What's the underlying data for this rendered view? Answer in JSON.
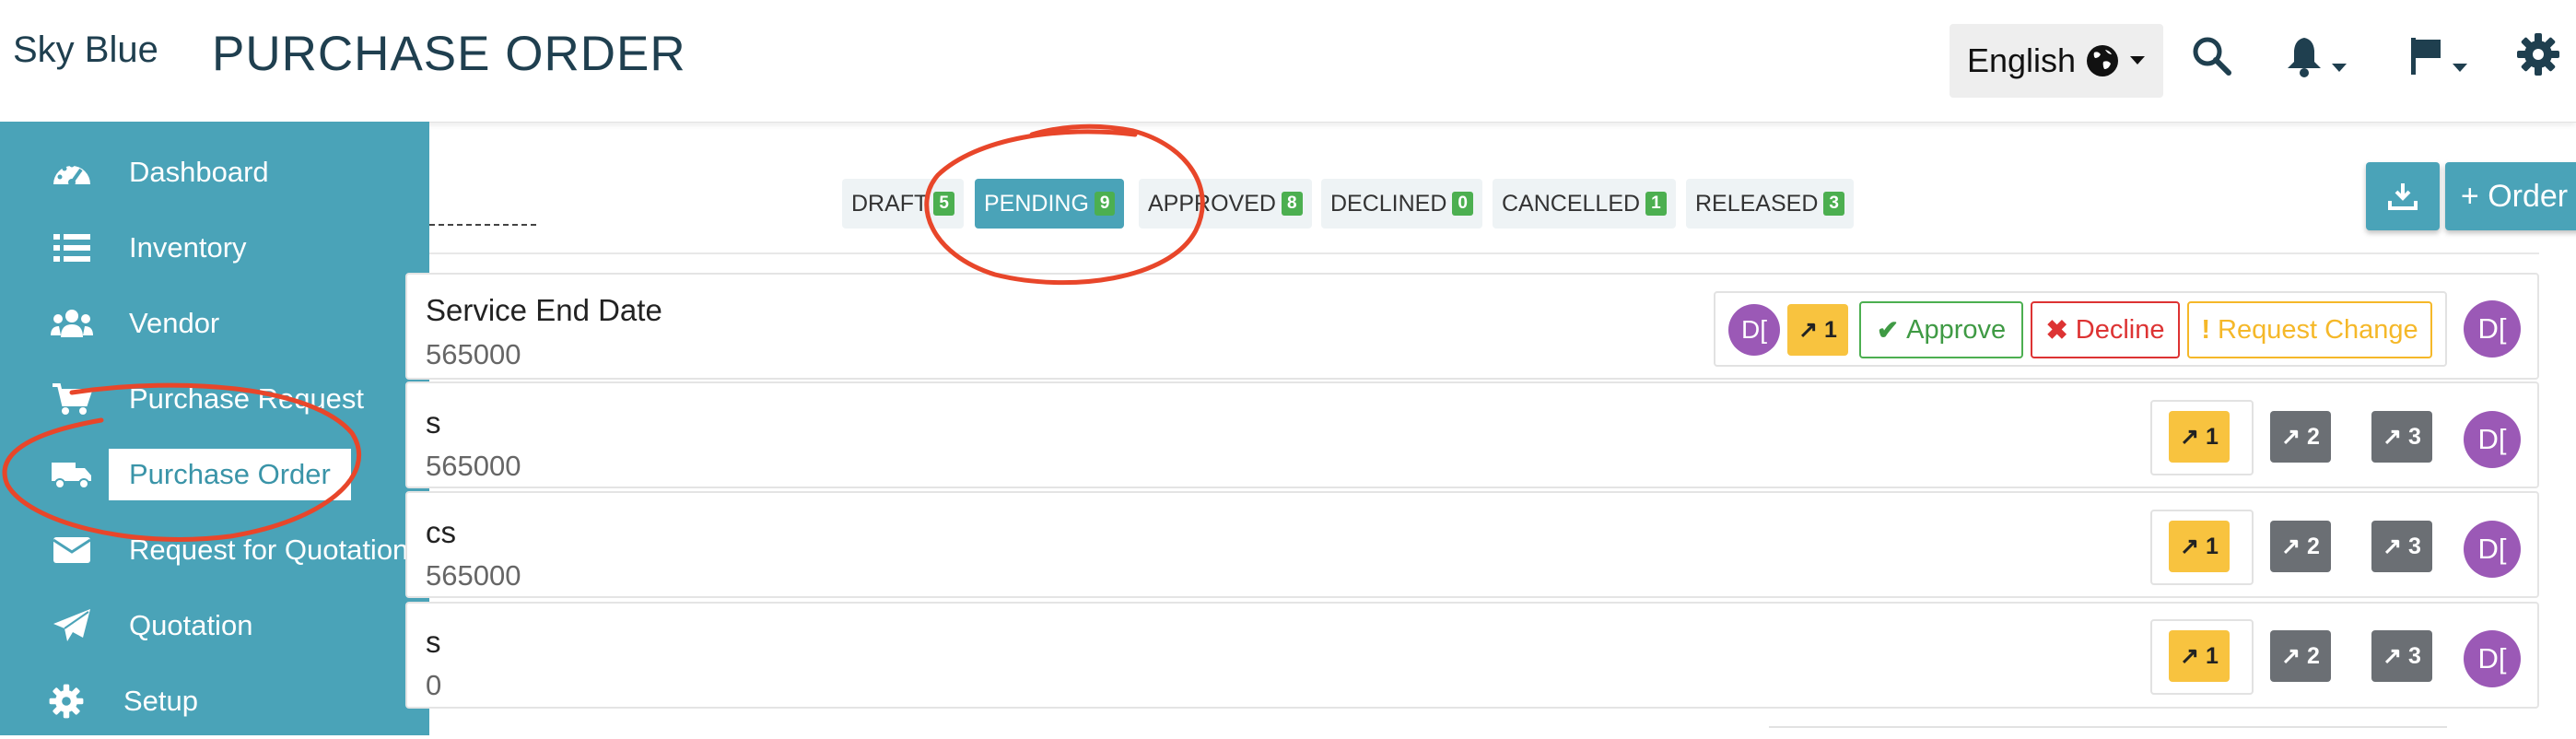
{
  "header": {
    "brand": "Sky Blue",
    "title": "PURCHASE ORDER",
    "language": "English"
  },
  "icons": {
    "globe": "globe-icon",
    "search": "search-icon",
    "bell": "bell-icon",
    "flag": "flag-icon",
    "gear": "gear-icon"
  },
  "sidebar": {
    "items": [
      {
        "label": "Dashboard",
        "icon": "dashboard-icon"
      },
      {
        "label": "Inventory",
        "icon": "list-icon"
      },
      {
        "label": "Vendor",
        "icon": "users-icon"
      },
      {
        "label": "Purchase Request",
        "icon": "cart-icon"
      },
      {
        "label": "Purchase Order",
        "icon": "truck-icon",
        "active": true
      },
      {
        "label": "Request for Quotation",
        "icon": "envelope-icon"
      },
      {
        "label": "Quotation",
        "icon": "paper-plane-icon"
      },
      {
        "label": "Setup",
        "icon": "gear-icon"
      }
    ]
  },
  "tabs": [
    {
      "label": "DRAFT",
      "count": "5"
    },
    {
      "label": "PENDING",
      "count": "9",
      "active": true
    },
    {
      "label": "APPROVED",
      "count": "8"
    },
    {
      "label": "DECLINED",
      "count": "0"
    },
    {
      "label": "CANCELLED",
      "count": "1"
    },
    {
      "label": "RELEASED",
      "count": "3"
    }
  ],
  "toolbar": {
    "download_icon": "download-icon",
    "add_order_label": "+ Order"
  },
  "rows": [
    {
      "title": "Service End Date",
      "subtitle": "565000",
      "avatar": "D["
    },
    {
      "title": "s",
      "subtitle": "565000",
      "avatar": "D["
    },
    {
      "title": "cs",
      "subtitle": "565000",
      "avatar": "D["
    },
    {
      "title": "s",
      "subtitle": "0",
      "avatar": "D["
    }
  ],
  "row1_actions": {
    "approver_avatar": "D[",
    "stage_label": "1",
    "approve_label": "Approve",
    "decline_label": "Decline",
    "request_change_label": "Request Change"
  },
  "stages": [
    "1",
    "2",
    "3"
  ],
  "colors": {
    "primary": "#4aa3b8",
    "badge_green": "#4caf50",
    "stage_yellow": "#f8c33f",
    "stage_gray": "#6b6f74",
    "avatar_purple": "#9b59b6",
    "approve_green": "#4caf50",
    "decline_red": "#dd3333",
    "request_orange": "#f5b829",
    "annotation_red": "#e8462a"
  }
}
